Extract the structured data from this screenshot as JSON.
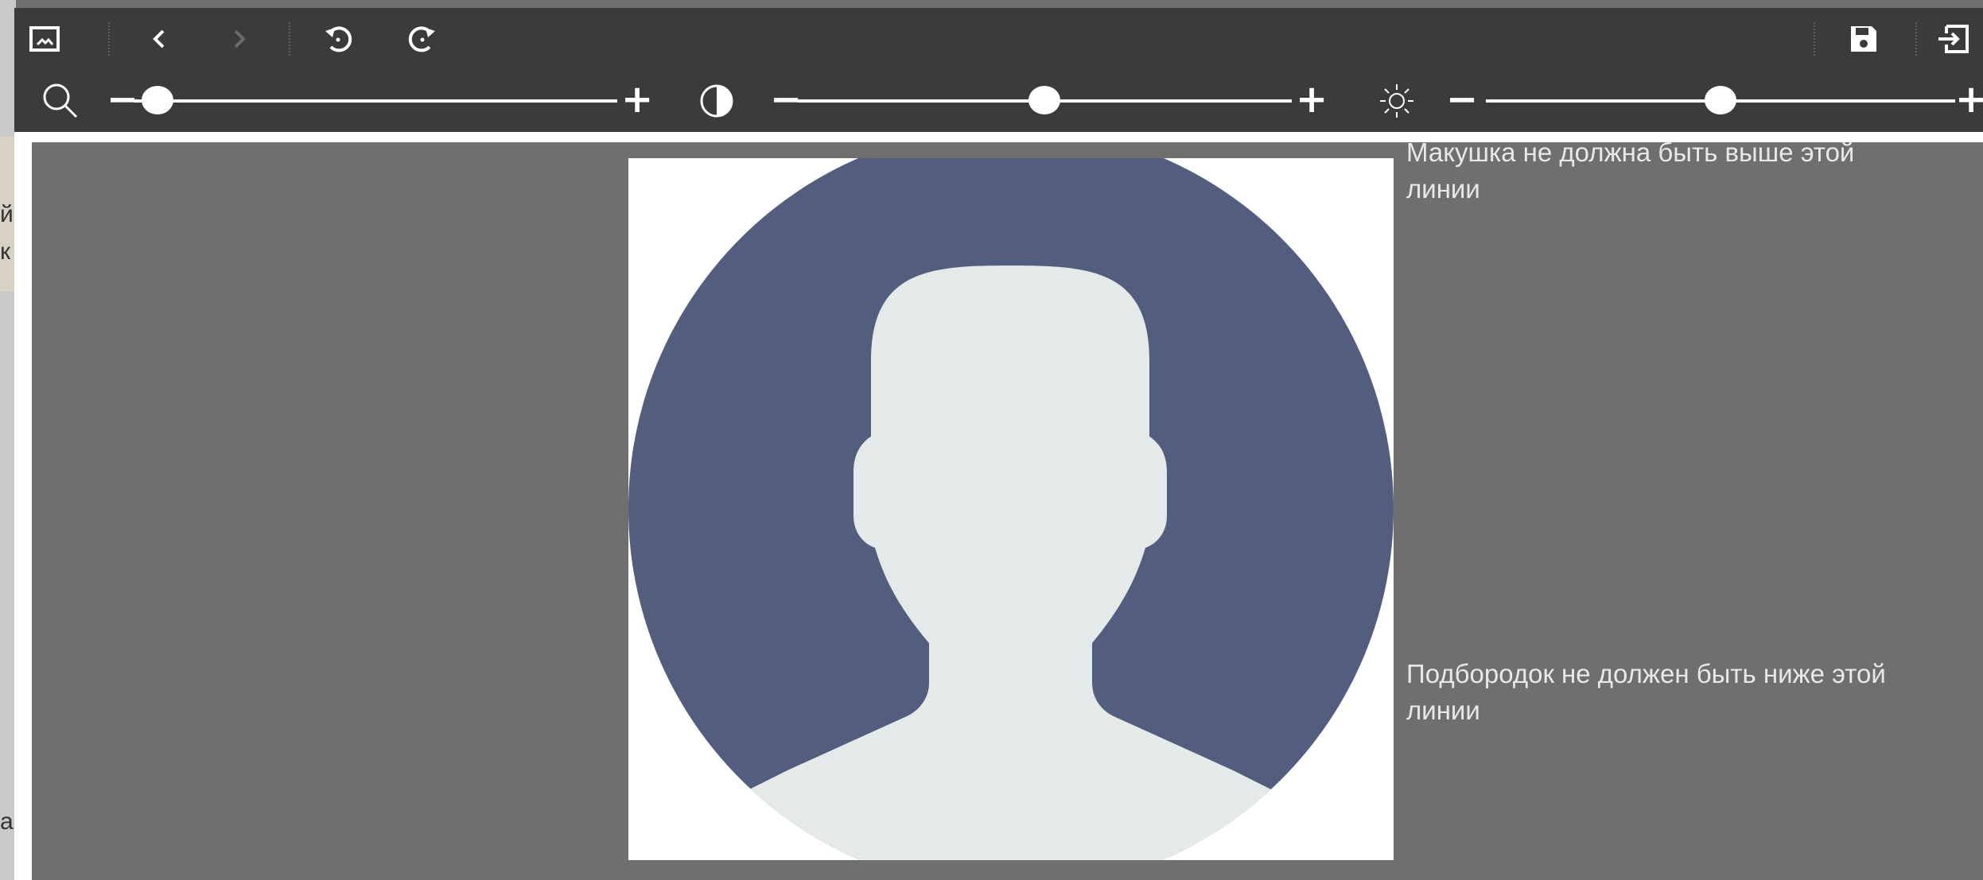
{
  "background_page": {
    "fragments": [
      "й",
      "к",
      "а"
    ]
  },
  "toolbar": {
    "buttons": [
      {
        "name": "image-icon"
      },
      {
        "name": "undo-back-icon"
      },
      {
        "name": "redo-forward-icon"
      },
      {
        "name": "rotate-left-icon"
      },
      {
        "name": "rotate-right-icon"
      },
      {
        "name": "save-icon"
      },
      {
        "name": "exit-icon"
      }
    ]
  },
  "adjustments": {
    "zoom": {
      "minus": "−",
      "plus": "+",
      "level": 0.05
    },
    "contrast": {
      "minus": "−",
      "plus": "+",
      "level": 0.5
    },
    "brightness": {
      "minus": "−",
      "plus": "+",
      "level": 0.5
    }
  },
  "guides": {
    "top_label": "Макушка не должна быть выше этой линии",
    "bottom_label": "Подбородок не должен быть ниже этой линии"
  },
  "colors": {
    "toolbar_bg": "#3b3b3b",
    "canvas_bg": "#6f6f6f",
    "avatar_circle": "#535e7e",
    "avatar_silhouette": "#e4e9ea"
  }
}
